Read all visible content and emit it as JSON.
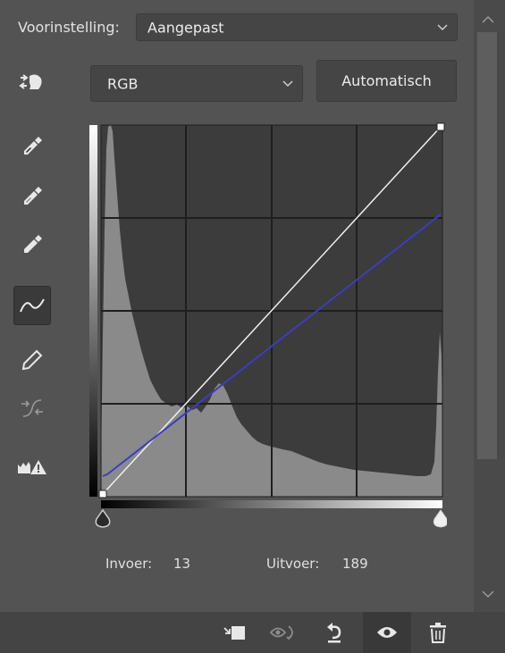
{
  "preset": {
    "label": "Voorinstelling:",
    "value": "Aangepast"
  },
  "channel": {
    "value": "RGB"
  },
  "auto_button": {
    "label": "Automatisch"
  },
  "tools": [
    "on-image-adjust-icon",
    "eyedropper-black-icon",
    "eyedropper-gray-icon",
    "eyedropper-white-icon",
    "curve-points-icon",
    "pencil-icon",
    "smooth-curve-icon",
    "clipping-warning-icon"
  ],
  "readout": {
    "input_label": "Invoer:",
    "input_value": "13",
    "output_label": "Uitvoer:",
    "output_value": "189"
  },
  "colors": {
    "panel_bg": "#535353",
    "graph_bg": "#3c3c3c",
    "histogram": "#8a8a8a",
    "blue_curve": "#3c3cc4",
    "rgb_curve": "#f0f0f0"
  },
  "footer_icons": [
    "clip-to-layer-icon",
    "view-previous-state-icon",
    "reset-icon",
    "visibility-eye-icon",
    "trash-icon"
  ]
}
